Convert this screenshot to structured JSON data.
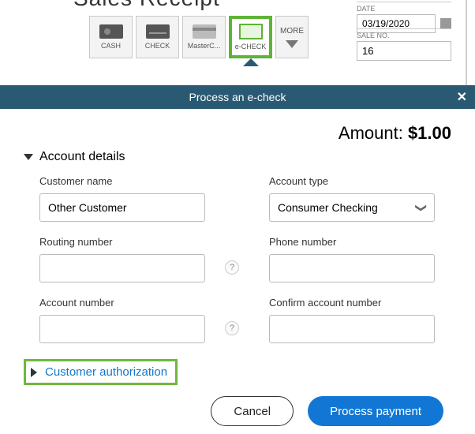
{
  "receipt": {
    "title": "Sales Receipt",
    "pay_methods": {
      "cash": "CASH",
      "check": "CHECK",
      "mastercard": "MasterC...",
      "echeck": "e-CHECK"
    },
    "more_label": "MORE",
    "date_label": "DATE",
    "date_value": "03/19/2020",
    "sale_no_label": "SALE NO.",
    "sale_no_value": "16"
  },
  "modal": {
    "title": "Process an e-check",
    "amount_label": "Amount: ",
    "amount_value": "$1.00",
    "section_account": "Account details",
    "fields": {
      "customer_name_label": "Customer name",
      "customer_name_value": "Other Customer",
      "account_type_label": "Account type",
      "account_type_value": "Consumer Checking",
      "routing_label": "Routing number",
      "routing_value": "",
      "phone_label": "Phone number",
      "phone_value": "",
      "account_num_label": "Account number",
      "account_num_value": "",
      "confirm_label": "Confirm account number",
      "confirm_value": ""
    },
    "auth_section": "Customer authorization",
    "cancel": "Cancel",
    "process": "Process payment"
  }
}
